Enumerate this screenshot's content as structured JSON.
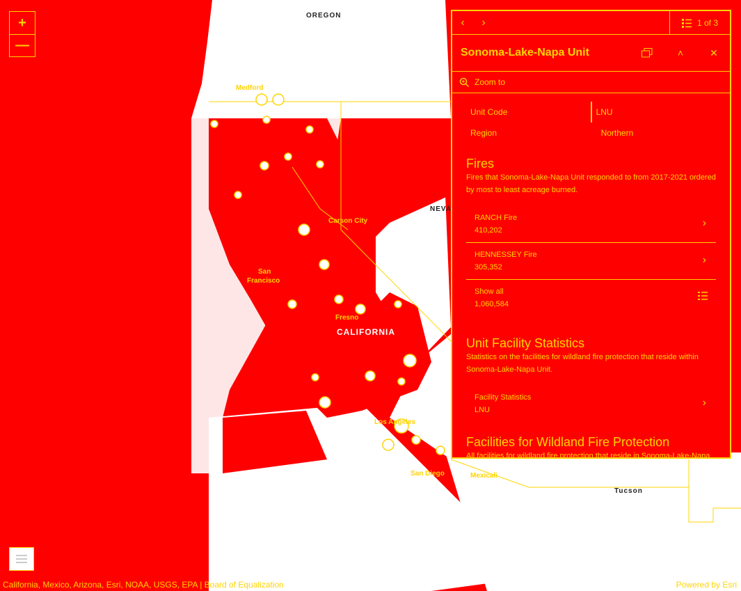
{
  "map": {
    "labels": {
      "oregon": "OREGON",
      "medford": "Medford",
      "nevada": "NEVA",
      "carson_city": "Carson City",
      "san_francisco_1": "San",
      "san_francisco_2": "Francisco",
      "fresno": "Fresno",
      "california": "CALIFORNIA",
      "los_angeles": "Los Angeles",
      "san_diego": "San Diego",
      "mexicali": "Mexicali",
      "tucson": "Tucson"
    },
    "zoom_in": "+",
    "zoom_out": "—",
    "attribution": "California, Mexico, Arizona, Esri, NOAA, USGS, EPA | Board of Equalization",
    "powered_by": "Powered by Esri"
  },
  "popup": {
    "prev_icon": "chevron-left-icon",
    "next_icon": "chevron-right-icon",
    "counter": "1 of 3",
    "title": "Sonoma-Lake-Napa Unit",
    "zoom_to": "Zoom to",
    "attributes": [
      {
        "label": "Unit Code",
        "value": "LNU"
      },
      {
        "label": "Region",
        "value": "Northern"
      }
    ],
    "fires": {
      "heading": "Fires",
      "description": "Fires that Sonoma-Lake-Napa Unit responded to from 2017-2021 ordered by most to least acreage burned.",
      "items": [
        {
          "name": "RANCH Fire",
          "value": "410,202"
        },
        {
          "name": "HENNESSEY Fire",
          "value": "305,352"
        }
      ],
      "show_all_label": "Show all",
      "show_all_value": "1,060,584"
    },
    "stats": {
      "heading": "Unit Facility Statistics",
      "description": "Statistics on the facilities for wildland fire protection that reside within Sonoma-Lake-Napa Unit.",
      "item_name": "Facility Statistics",
      "item_value": "LNU"
    },
    "facilities": {
      "heading": "Facilities for Wildland Fire Protection",
      "description": "All facilities for wildland fire protection that reside in Sonoma-Lake-Napa Unit."
    }
  },
  "colors": {
    "background": "#ff0000",
    "accent": "#ffd400",
    "land": "#ffffff"
  }
}
